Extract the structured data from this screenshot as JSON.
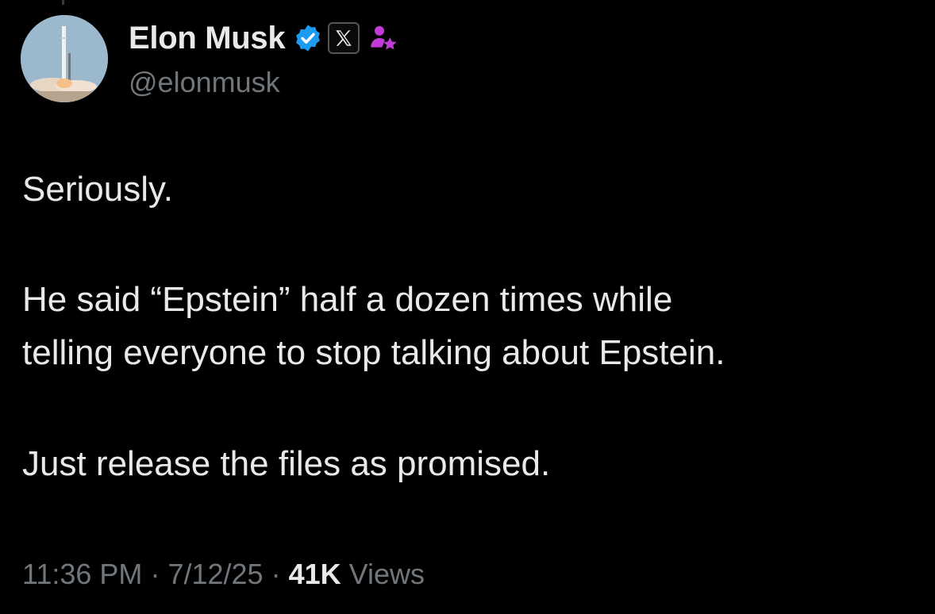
{
  "tweet": {
    "author": {
      "name": "Elon Musk",
      "handle": "@elonmusk",
      "verified_color": "#1d9bf0",
      "affiliation_icon": "x-logo-icon",
      "badge_icon": "person-star-icon",
      "badge_color": "#c13bd6"
    },
    "paragraphs": [
      "Seriously.",
      "He said “Epstein” half a dozen times while",
      "telling everyone to stop talking about Epstein.",
      "Just release the files as promised."
    ],
    "meta": {
      "time": "11:36 PM",
      "separator": "·",
      "date": "7/12/25",
      "views_count": "41K",
      "views_label": "Views"
    }
  }
}
